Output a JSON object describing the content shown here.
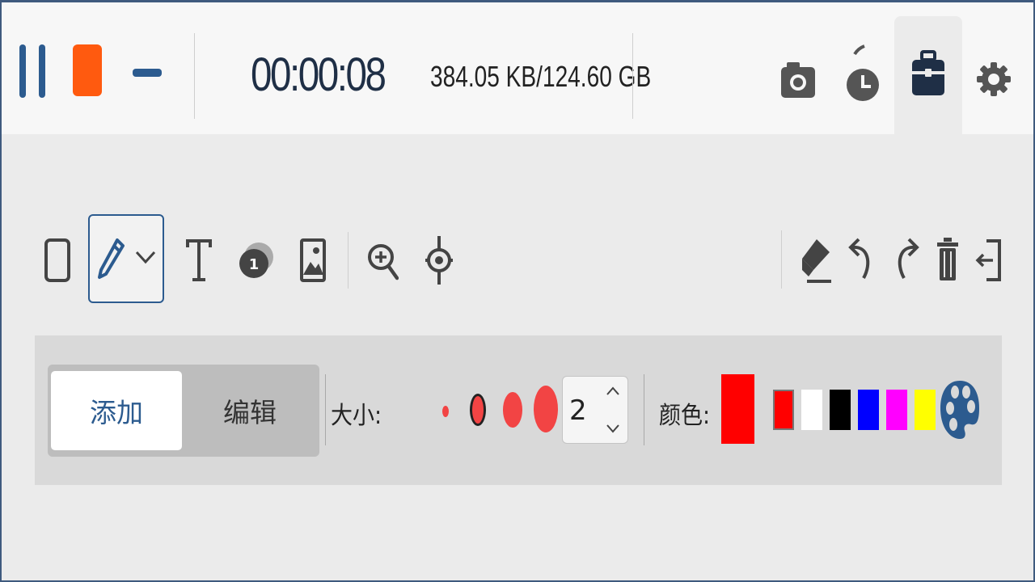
{
  "recorder": {
    "timer": "00:00:08",
    "storage": "384.05 KB/124.60 GB",
    "accent_color": "#2c5b8f",
    "stop_color": "#ff5a0f",
    "icons": [
      "pause-icon",
      "stop-icon",
      "minimize-icon",
      "camera-icon",
      "timer-icon",
      "toolbox-icon",
      "gear-icon"
    ]
  },
  "tools": {
    "selected": "pen",
    "left_icons": [
      "rectangle-icon",
      "pen-icon",
      "chevron-down-icon",
      "text-icon",
      "step-number-icon",
      "image-icon",
      "zoom-in-icon",
      "spotlight-icon"
    ],
    "right_icons": [
      "eraser-icon",
      "undo-icon",
      "redo-icon",
      "trash-icon",
      "exit-icon"
    ]
  },
  "options": {
    "mode_add": "添加",
    "mode_edit": "编辑",
    "size_label": "大小:",
    "size_value": "2",
    "color_label": "颜色:",
    "current_color": "#ff0000",
    "palette": [
      "#ff0000",
      "#ffffff",
      "#000000",
      "#0000ff",
      "#ff00ff",
      "#ffff00"
    ],
    "dot_color": "#f24444"
  }
}
